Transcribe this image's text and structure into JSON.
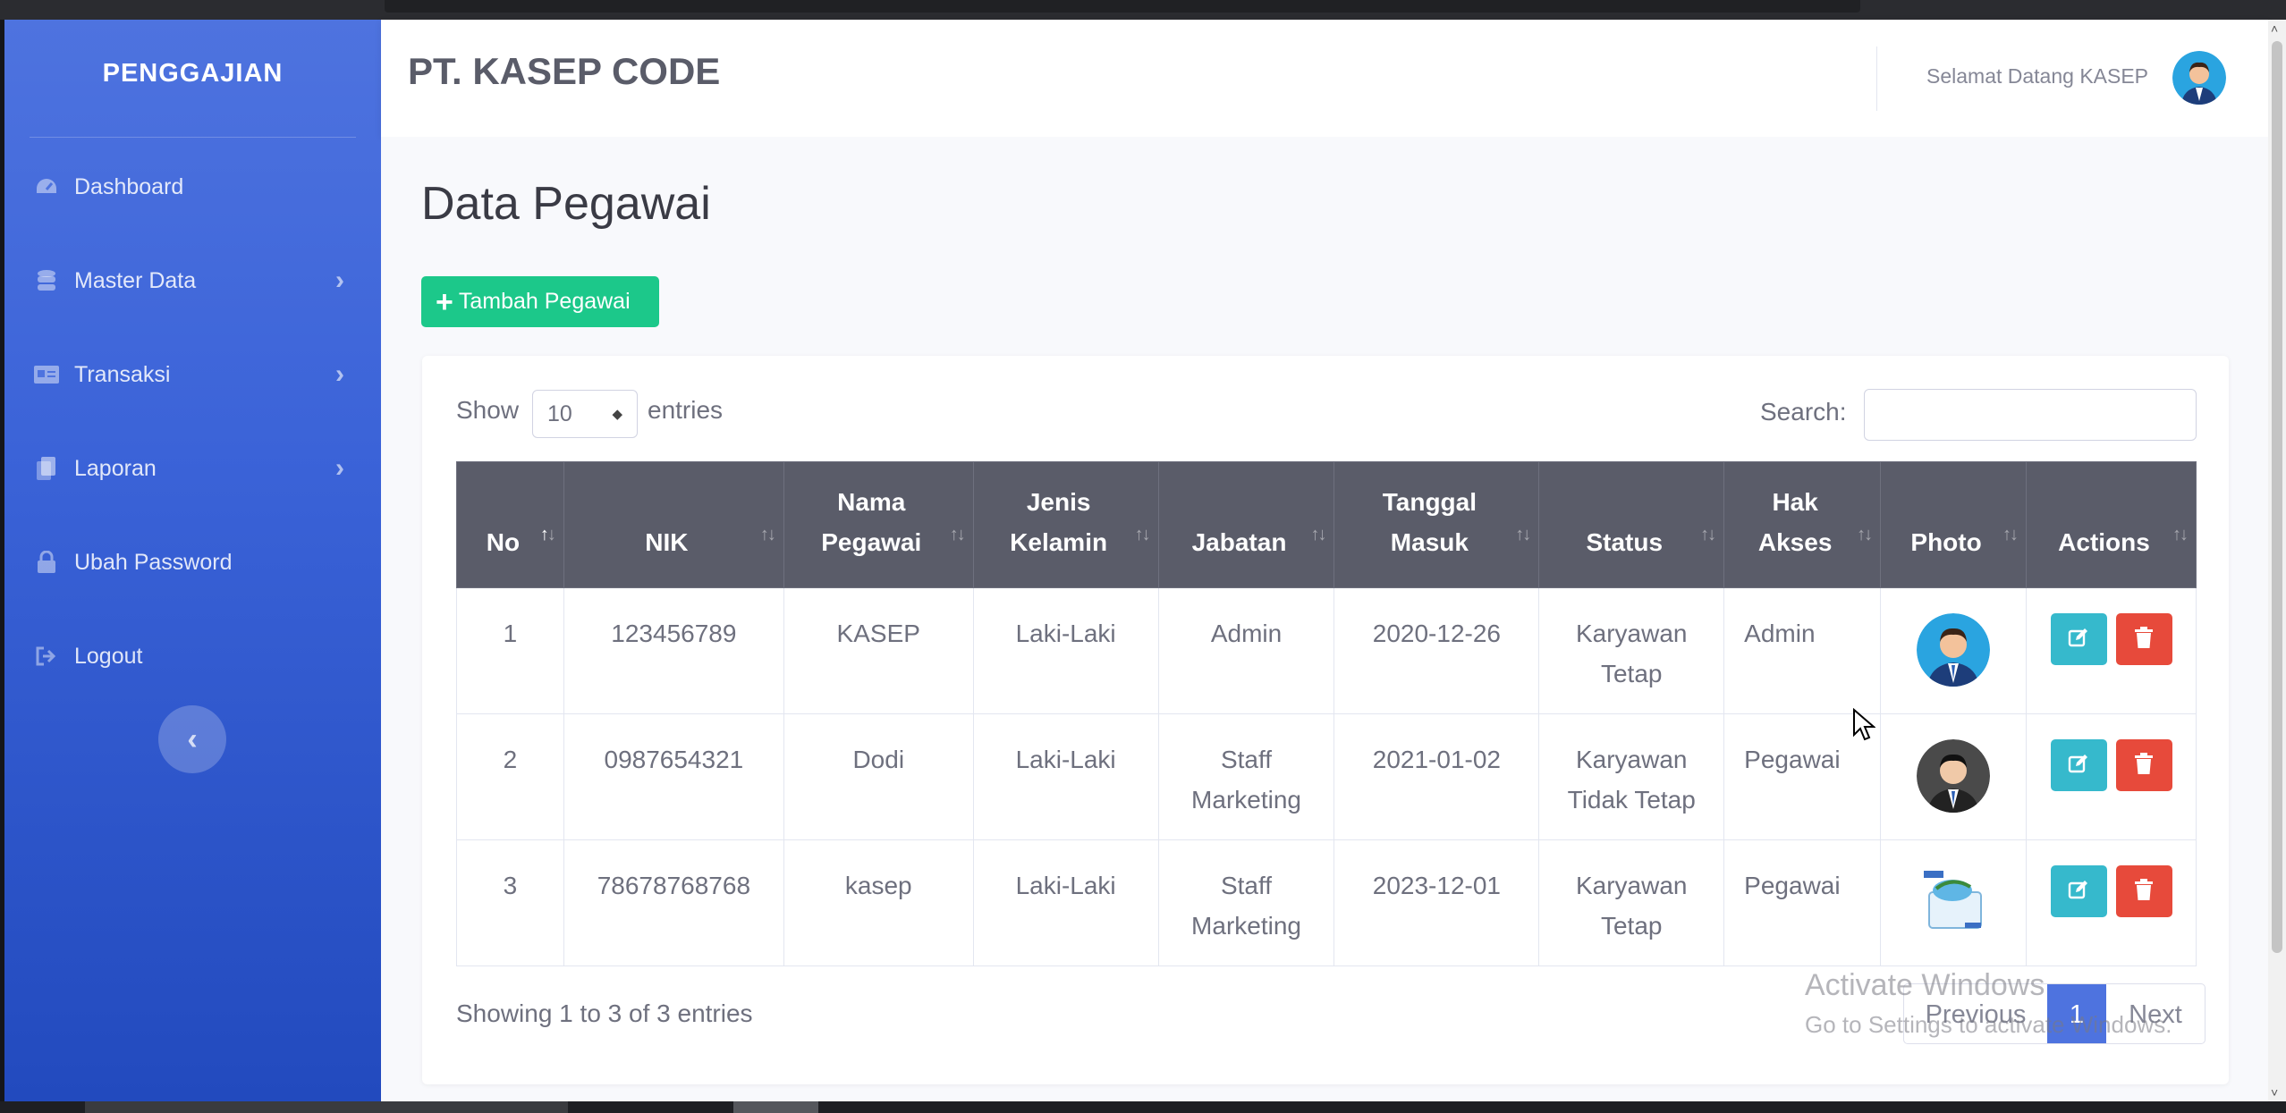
{
  "sidebar": {
    "brand": "PENGGAJIAN",
    "items": [
      {
        "label": "Dashboard",
        "icon": "tachometer-icon"
      },
      {
        "label": "Master Data",
        "icon": "database-icon"
      },
      {
        "label": "Transaksi",
        "icon": "id-card-icon"
      },
      {
        "label": "Laporan",
        "icon": "copy-icon"
      },
      {
        "label": "Ubah Password",
        "icon": "lock-icon"
      },
      {
        "label": "Logout",
        "icon": "sign-out-icon"
      }
    ]
  },
  "topbar": {
    "company": "PT. KASEP CODE",
    "welcome": "Selamat Datang KASEP"
  },
  "page": {
    "title": "Data Pegawai",
    "add_button": "Tambah Pegawai"
  },
  "datatable": {
    "show_label": "Show",
    "entries_value": "10",
    "entries_label": "entries",
    "search_label": "Search:",
    "search_value": "",
    "columns": [
      {
        "line1": "",
        "line2": "No"
      },
      {
        "line1": "",
        "line2": "NIK"
      },
      {
        "line1": "Nama",
        "line2": "Pegawai"
      },
      {
        "line1": "Jenis",
        "line2": "Kelamin"
      },
      {
        "line1": "",
        "line2": "Jabatan"
      },
      {
        "line1": "Tanggal",
        "line2": "Masuk"
      },
      {
        "line1": "",
        "line2": "Status"
      },
      {
        "line1": "Hak",
        "line2": "Akses"
      },
      {
        "line1": "",
        "line2": "Photo"
      },
      {
        "line1": "",
        "line2": "Actions"
      }
    ],
    "rows": [
      {
        "no": "1",
        "nik": "123456789",
        "nama": "KASEP",
        "jk": "Laki-Laki",
        "jabatan_1": "Admin",
        "jabatan_2": "",
        "tanggal": "2020-12-26",
        "status_1": "Karyawan",
        "status_2": "Tetap",
        "akses": "Admin"
      },
      {
        "no": "2",
        "nik": "0987654321",
        "nama": "Dodi",
        "jk": "Laki-Laki",
        "jabatan_1": "Staff",
        "jabatan_2": "Marketing",
        "tanggal": "2021-01-02",
        "status_1": "Karyawan",
        "status_2": "Tidak Tetap",
        "akses": "Pegawai"
      },
      {
        "no": "3",
        "nik": "78678768768",
        "nama": "kasep",
        "jk": "Laki-Laki",
        "jabatan_1": "Staff",
        "jabatan_2": "Marketing",
        "tanggal": "2023-12-01",
        "status_1": "Karyawan",
        "status_2": "Tetap",
        "akses": "Pegawai"
      }
    ],
    "info": "Showing 1 to 3 of 3 entries",
    "pagination": {
      "previous": "Previous",
      "current": "1",
      "next": "Next"
    }
  },
  "watermark": {
    "line1": "Activate Windows",
    "line2": "Go to Settings to activate Windows."
  },
  "colors": {
    "sidebar_top": "#4e73df",
    "sidebar_bottom": "#224abe",
    "success": "#1cc88a",
    "info": "#36b9cc",
    "danger": "#e74a3b",
    "table_header": "#5a5c69"
  }
}
